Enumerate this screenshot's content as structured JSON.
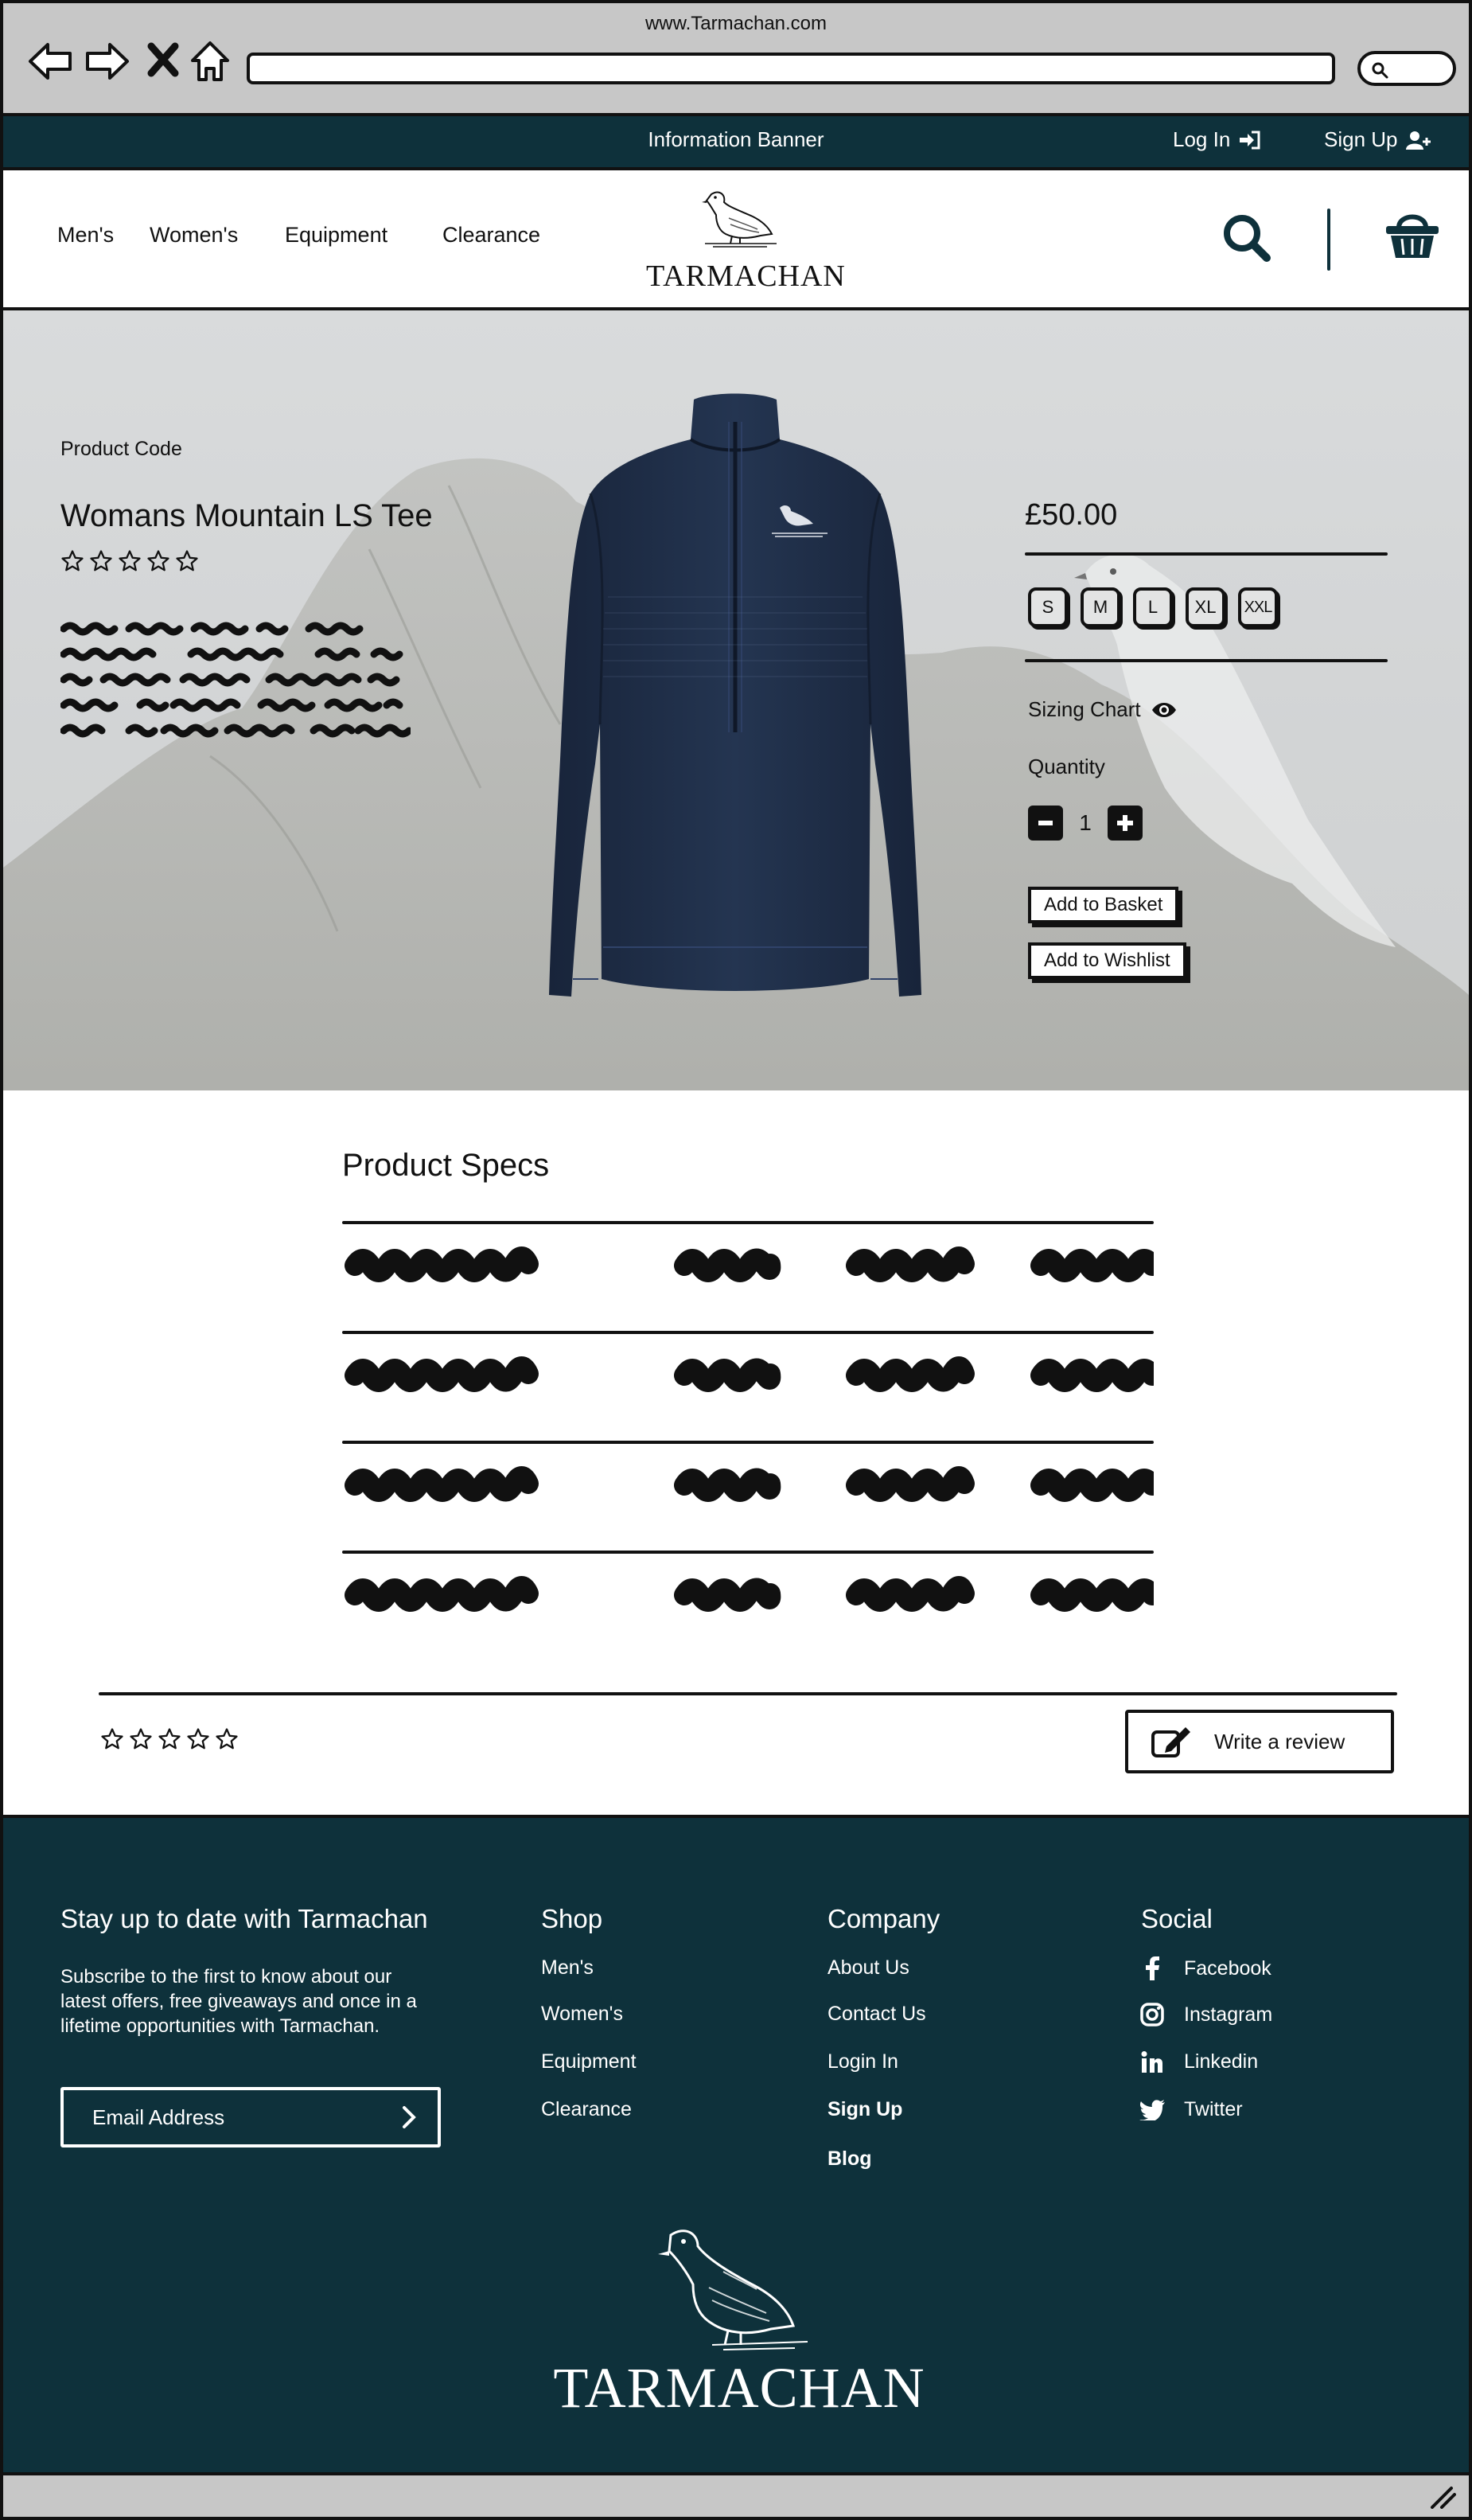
{
  "browser": {
    "url_title": "www.Tarmachan.com",
    "icons": [
      "back-arrow-icon",
      "forward-arrow-icon",
      "close-icon",
      "home-icon",
      "search-icon"
    ]
  },
  "banner": {
    "info": "Information Banner",
    "login": "Log In",
    "signup": "Sign Up",
    "icons": [
      "login-icon",
      "add-user-icon"
    ]
  },
  "nav": {
    "links": [
      "Men's",
      "Women's",
      "Equipment",
      "Clearance"
    ],
    "logo_text": "TARMACHAN",
    "icons": [
      "search-icon",
      "basket-icon"
    ]
  },
  "product": {
    "code_label": "Product Code",
    "name": "Womans Mountain LS Tee",
    "rating_max": 5,
    "rating": 0,
    "price": "£50.00",
    "sizes": [
      "S",
      "M",
      "L",
      "XL",
      "XXL"
    ],
    "sizing_chart": "Sizing Chart",
    "quantity_label": "Quantity",
    "quantity": "1",
    "add_to_basket": "Add to Basket",
    "add_to_wishlist": "Add to Wishlist",
    "icons": [
      "eye-icon",
      "minus-icon",
      "plus-icon",
      "star-icon"
    ]
  },
  "specs": {
    "heading": "Product Specs",
    "write_review": "Write a review",
    "review_rating": 0,
    "icons": [
      "edit-icon"
    ]
  },
  "footer": {
    "newsletter_title": "Stay up to date with Tarmachan",
    "newsletter_text": "Subscribe to the first to know about our latest offers, free giveaways and once in a lifetime opportunities with Tarmachan.",
    "email_placeholder": "Email Address",
    "shop_title": "Shop",
    "shop_links": [
      "Men's",
      "Women's",
      "Equipment",
      "Clearance"
    ],
    "company_title": "Company",
    "company_links": [
      "About Us",
      "Contact Us",
      "Login In",
      "Sign Up",
      "Blog"
    ],
    "social_title": "Social",
    "social_links": [
      {
        "label": "Facebook",
        "icon": "facebook-icon"
      },
      {
        "label": "Instagram",
        "icon": "instagram-icon"
      },
      {
        "label": "Linkedin",
        "icon": "linkedin-icon"
      },
      {
        "label": "Twitter",
        "icon": "twitter-icon"
      }
    ],
    "logo_text": "TARMACHAN"
  },
  "colors": {
    "brand_dark": "#0e313b",
    "chrome_grey": "#c7c7c7",
    "ink": "#111111",
    "shirt_navy": "#1c2a3f"
  }
}
